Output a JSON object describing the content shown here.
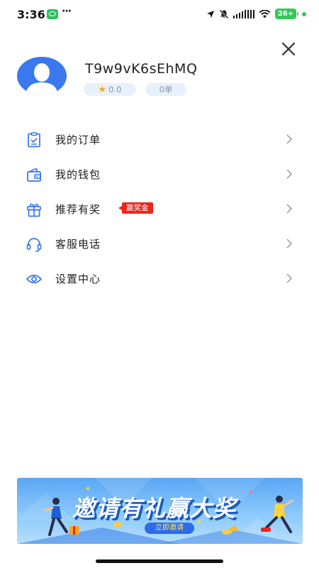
{
  "status_bar": {
    "time": "3:36",
    "more": "···",
    "battery": "26+",
    "icons": [
      "wechat-icon",
      "location-arrow-icon",
      "mute-bell-icon",
      "signal-icon",
      "wifi-icon",
      "battery-icon"
    ],
    "accent": "#34c759"
  },
  "profile": {
    "username": "T9w9vK6sEhMQ",
    "rating": "0.0",
    "orders": "0单",
    "avatar_color": "#3a78f0"
  },
  "menu": {
    "items": [
      {
        "label": "我的订单",
        "icon": "clipboard-check-icon"
      },
      {
        "label": "我的钱包",
        "icon": "wallet-icon"
      },
      {
        "label": "推荐有奖",
        "icon": "gift-icon",
        "badge": "赢奖金"
      },
      {
        "label": "客服电话",
        "icon": "headset-icon"
      },
      {
        "label": "设置中心",
        "icon": "eye-settings-icon"
      }
    ],
    "icon_color": "#3a78f0"
  },
  "banner": {
    "title": "邀请有礼赢大奖",
    "button": "立即邀请"
  }
}
